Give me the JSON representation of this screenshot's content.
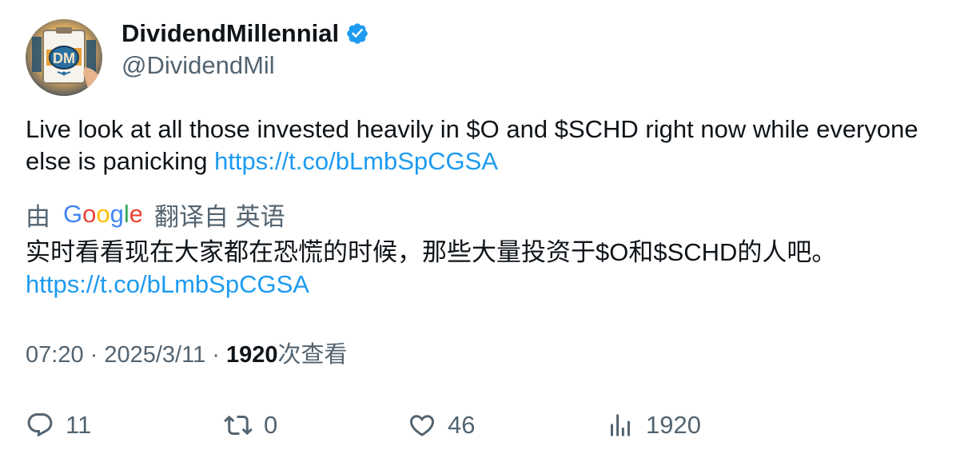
{
  "author": {
    "display_name": "DividendMillennial",
    "handle": "@DividendMil",
    "verified_icon": "verified-badge-icon",
    "avatar_initials": "DM",
    "brand_color": "#1d9bf0"
  },
  "tweet": {
    "text": "Live look at all those invested heavily in $O and $SCHD right now while everyone else is panicking ",
    "link": "https://t.co/bLmbSpCGSA"
  },
  "translation": {
    "prefix": "由",
    "provider": "Google",
    "suffix": "翻译自 英语",
    "text": "实时看看现在大家都在恐慌的时候，那些大量投资于$O和$SCHD的人吧。",
    "link": "https://t.co/bLmbSpCGSA"
  },
  "meta": {
    "time": "07:20",
    "separator": " · ",
    "date": "2025/3/11",
    "views_count": "1920",
    "views_label": "次查看"
  },
  "actions": {
    "reply": {
      "icon": "reply-icon",
      "count": "11"
    },
    "retweet": {
      "icon": "retweet-icon",
      "count": "0"
    },
    "like": {
      "icon": "heart-icon",
      "count": "46"
    },
    "views": {
      "icon": "analytics-icon",
      "count": "1920"
    }
  }
}
